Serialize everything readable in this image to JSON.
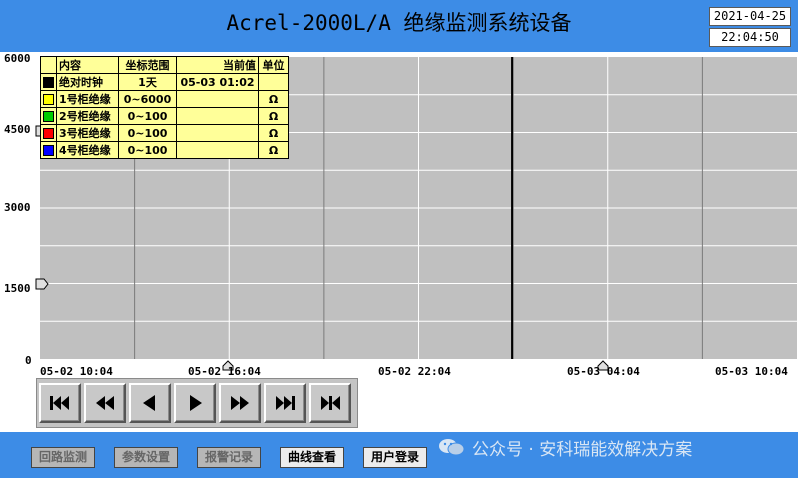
{
  "header": {
    "title": "Acrel-2000L/A 绝缘监测系统设备",
    "date": "2021-04-25",
    "time": "22:04:50"
  },
  "chart_data": {
    "type": "line",
    "y_ticks": [
      "6000",
      "4500",
      "3000",
      "1500",
      "0"
    ],
    "x_ticks": [
      "05-02 10:04",
      "05-02 16:04",
      "05-02 22:04",
      "05-03 04:04",
      "05-03 10:04"
    ],
    "ylim": [
      0,
      6000
    ],
    "x_range": [
      "05-02 10:04",
      "05-03 10:04"
    ],
    "cursor_x": "05-03 01:02",
    "grid": true,
    "series": []
  },
  "legend": {
    "headers": {
      "content": "内容",
      "range": "坐标范围",
      "current": "当前值",
      "unit": "单位"
    },
    "rows": [
      {
        "color": "#000000",
        "name": "绝对时钟",
        "range": "1天",
        "current": "05-03 01:02",
        "unit": ""
      },
      {
        "color": "#ffff00",
        "name": "1号柜绝缘",
        "range": "0~6000",
        "current": "",
        "unit": "Ω"
      },
      {
        "color": "#00cc00",
        "name": "2号柜绝缘",
        "range": "0~100",
        "current": "",
        "unit": "Ω"
      },
      {
        "color": "#ff0000",
        "name": "3号柜绝缘",
        "range": "0~100",
        "current": "",
        "unit": "Ω"
      },
      {
        "color": "#0000ff",
        "name": "4号柜绝缘",
        "range": "0~100",
        "current": "",
        "unit": "Ω"
      }
    ]
  },
  "nav": [
    {
      "name": "first-page-icon"
    },
    {
      "name": "fast-backward-icon"
    },
    {
      "name": "step-backward-icon"
    },
    {
      "name": "step-forward-icon"
    },
    {
      "name": "fast-forward-icon"
    },
    {
      "name": "last-page-icon"
    },
    {
      "name": "go-to-latest-icon"
    }
  ],
  "footer": {
    "buttons": [
      {
        "label": "回路监测",
        "active": false
      },
      {
        "label": "参数设置",
        "active": false
      },
      {
        "label": "报警记录",
        "active": false
      },
      {
        "label": "曲线查看",
        "active": true
      },
      {
        "label": "用户登录",
        "active": true
      }
    ],
    "brand": "公众号 · 安科瑞能效解决方案"
  },
  "colors": {
    "header_bg": "#3d8ce6",
    "plot_bg": "#c0c0c0",
    "legend_bg": "#ffff99"
  }
}
